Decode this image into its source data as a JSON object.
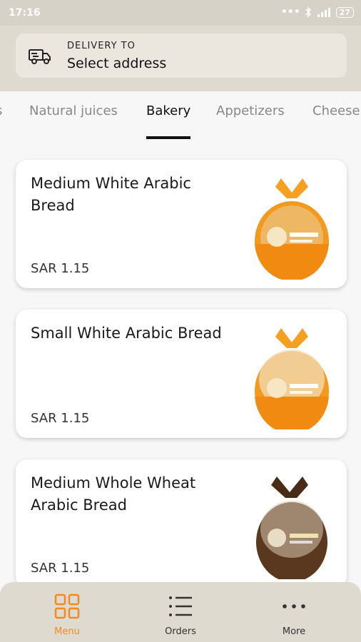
{
  "status_bar": {
    "time": "17:16",
    "battery": "27"
  },
  "header": {
    "delivery_label": "DELIVERY TO",
    "address": "Select address"
  },
  "tabs": [
    {
      "label": "s"
    },
    {
      "label": "Natural juices"
    },
    {
      "label": "Bakery"
    },
    {
      "label": "Appetizers"
    },
    {
      "label": "Cheese"
    }
  ],
  "active_tab": "Bakery",
  "products": [
    {
      "name": "Medium White Arabic Bread",
      "price": "SAR 1.15"
    },
    {
      "name": "Small White Arabic Bread",
      "price": "SAR 1.15"
    },
    {
      "name": "Medium Whole Wheat Arabic Bread",
      "price": "SAR 1.15"
    }
  ],
  "bottom_nav": [
    {
      "label": "Menu",
      "icon": "grid-icon"
    },
    {
      "label": "Orders",
      "icon": "list-icon"
    },
    {
      "label": "More",
      "icon": "more-dots-icon"
    }
  ],
  "colors": {
    "accent": "#f28b1c",
    "header_bg": "#dedad0"
  }
}
